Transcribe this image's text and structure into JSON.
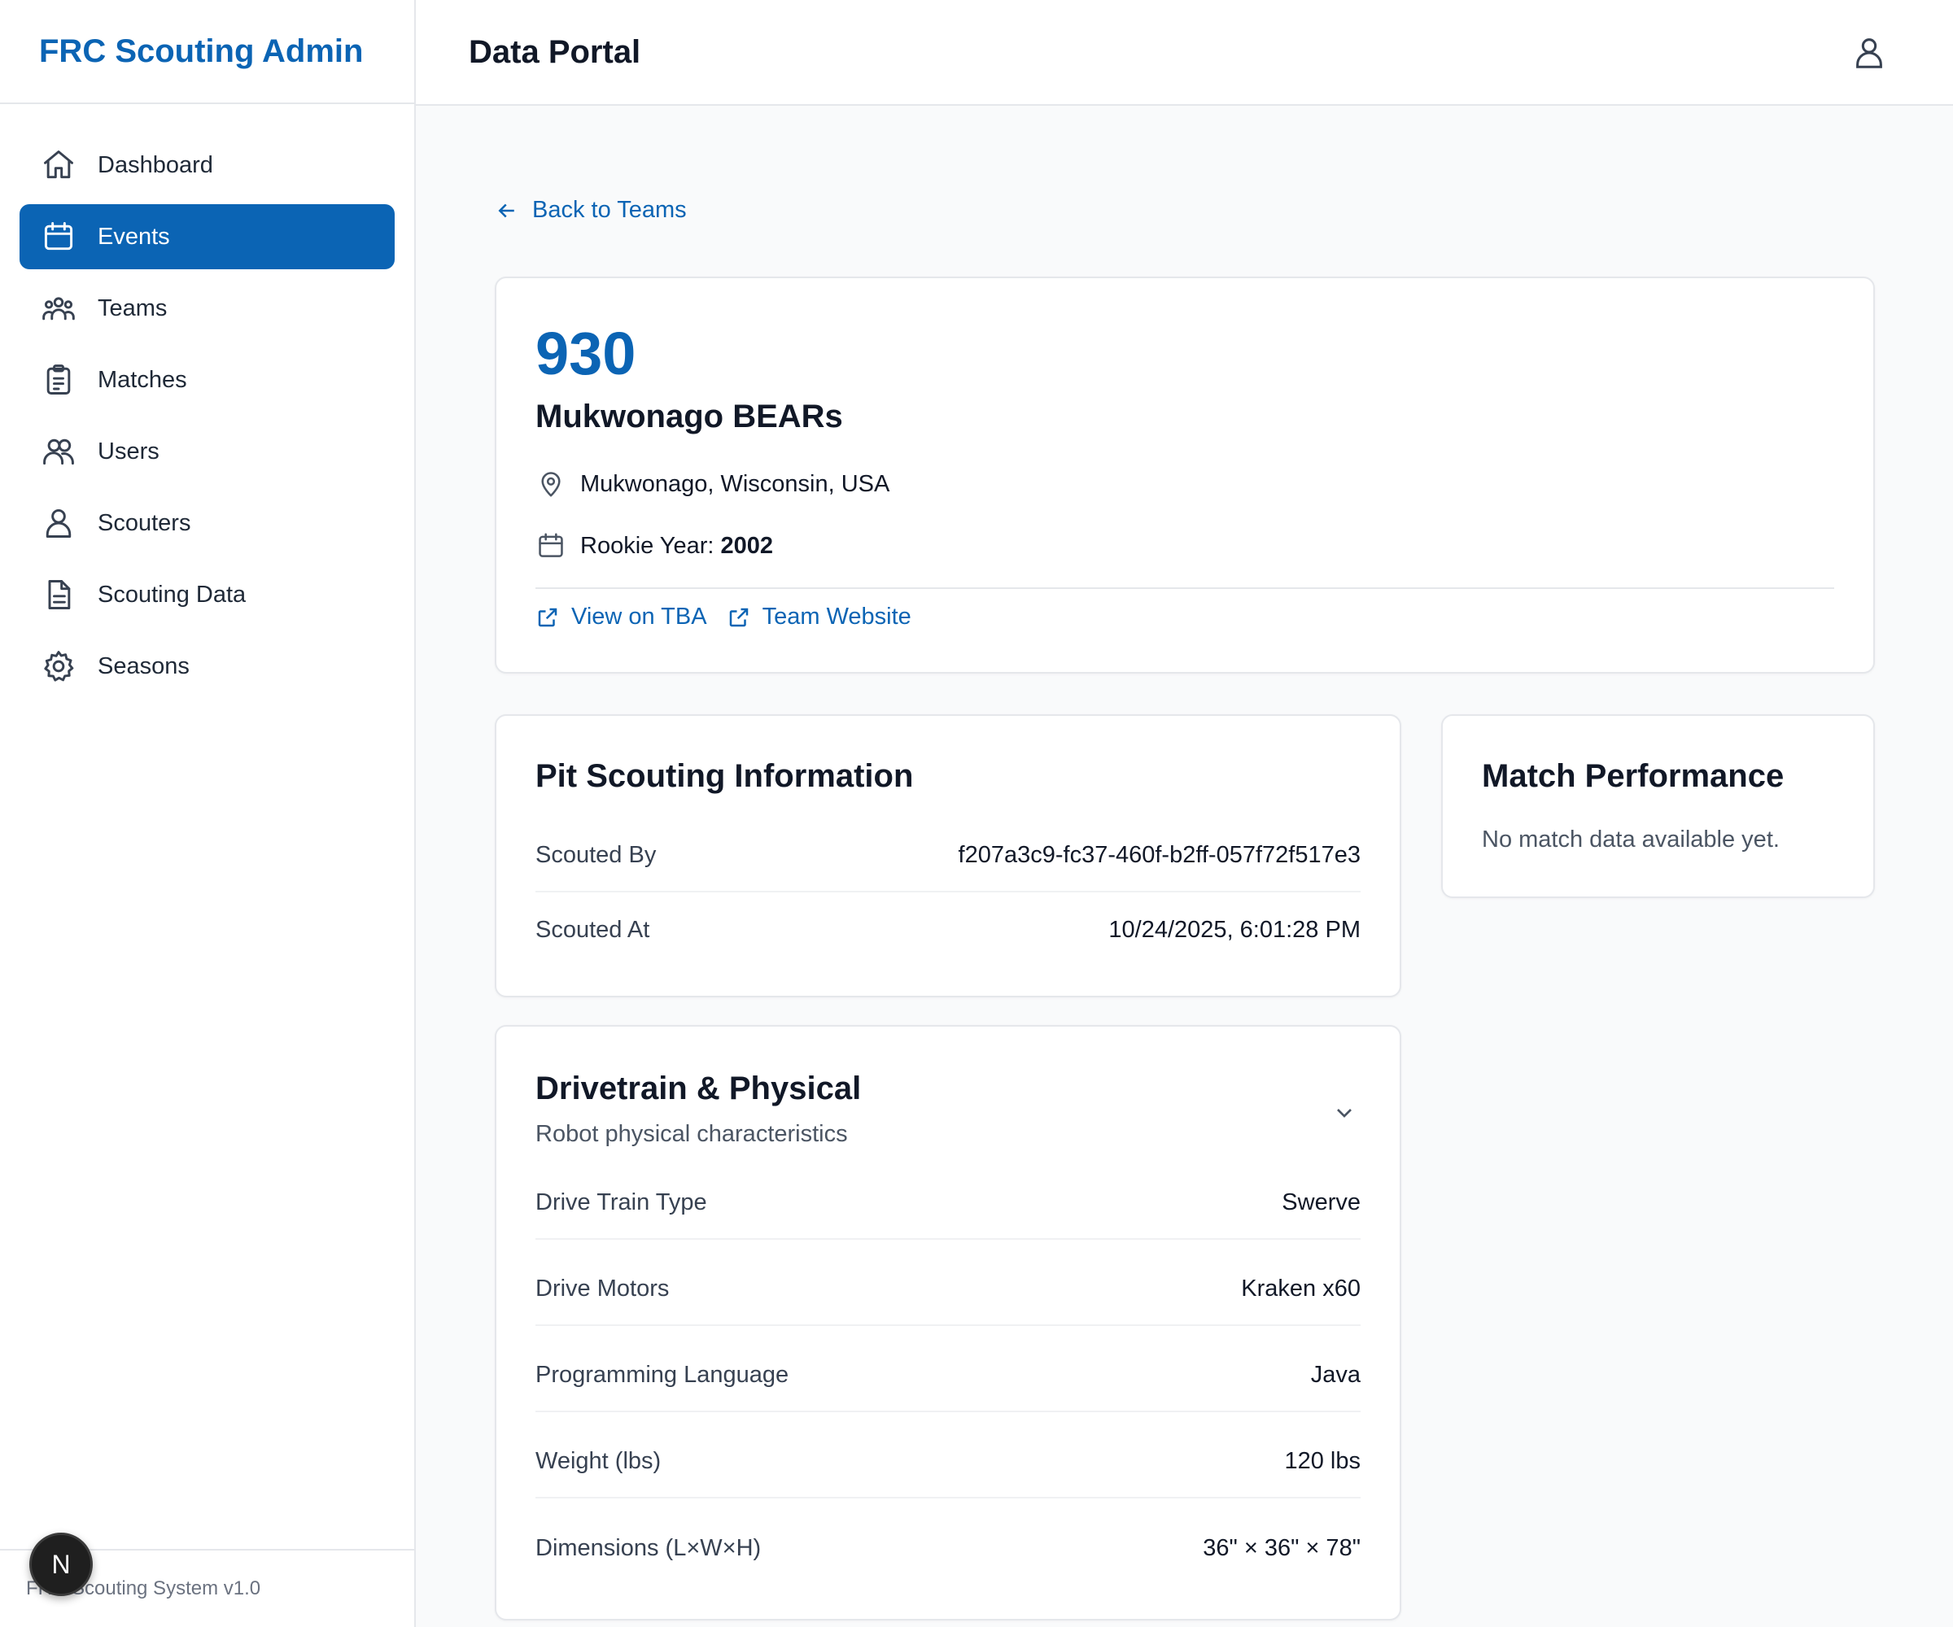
{
  "brand": {
    "title": "FRC Scouting Admin"
  },
  "sidebar": {
    "items": [
      {
        "label": "Dashboard",
        "icon": "home-icon",
        "active": false
      },
      {
        "label": "Events",
        "icon": "calendar-icon",
        "active": true
      },
      {
        "label": "Teams",
        "icon": "team-icon",
        "active": false
      },
      {
        "label": "Matches",
        "icon": "clipboard-icon",
        "active": false
      },
      {
        "label": "Users",
        "icon": "users-icon",
        "active": false
      },
      {
        "label": "Scouters",
        "icon": "user-icon",
        "active": false
      },
      {
        "label": "Scouting Data",
        "icon": "document-icon",
        "active": false
      },
      {
        "label": "Seasons",
        "icon": "gear-icon",
        "active": false
      }
    ],
    "footer": "FRC Scouting System v1.0",
    "badge": "N"
  },
  "header": {
    "title": "Data Portal",
    "user_icon": "user-icon"
  },
  "back_link": {
    "label": "Back to Teams"
  },
  "team": {
    "number": "930",
    "name": "Mukwonago BEARs",
    "location": "Mukwonago, Wisconsin, USA",
    "rookie_label": "Rookie Year:",
    "rookie_year": "2002",
    "links": {
      "tba": "View on TBA",
      "website": "Team Website"
    }
  },
  "pit": {
    "title": "Pit Scouting Information",
    "rows": [
      {
        "key": "Scouted By",
        "value": "f207a3c9-fc37-460f-b2ff-057f72f517e3"
      },
      {
        "key": "Scouted At",
        "value": "10/24/2025, 6:01:28 PM"
      }
    ]
  },
  "match": {
    "title": "Match Performance",
    "empty": "No match data available yet."
  },
  "drivetrain": {
    "title": "Drivetrain & Physical",
    "subtitle": "Robot physical characteristics",
    "rows": [
      {
        "key": "Drive Train Type",
        "value": "Swerve"
      },
      {
        "key": "Drive Motors",
        "value": "Kraken x60"
      },
      {
        "key": "Programming Language",
        "value": "Java"
      },
      {
        "key": "Weight (lbs)",
        "value": "120 lbs"
      },
      {
        "key": "Dimensions (L×W×H)",
        "value": "36\" × 36\" × 78\""
      }
    ]
  },
  "colors": {
    "accent": "#0b64b4",
    "border": "#e5e7eb",
    "background": "#f9fafb"
  }
}
